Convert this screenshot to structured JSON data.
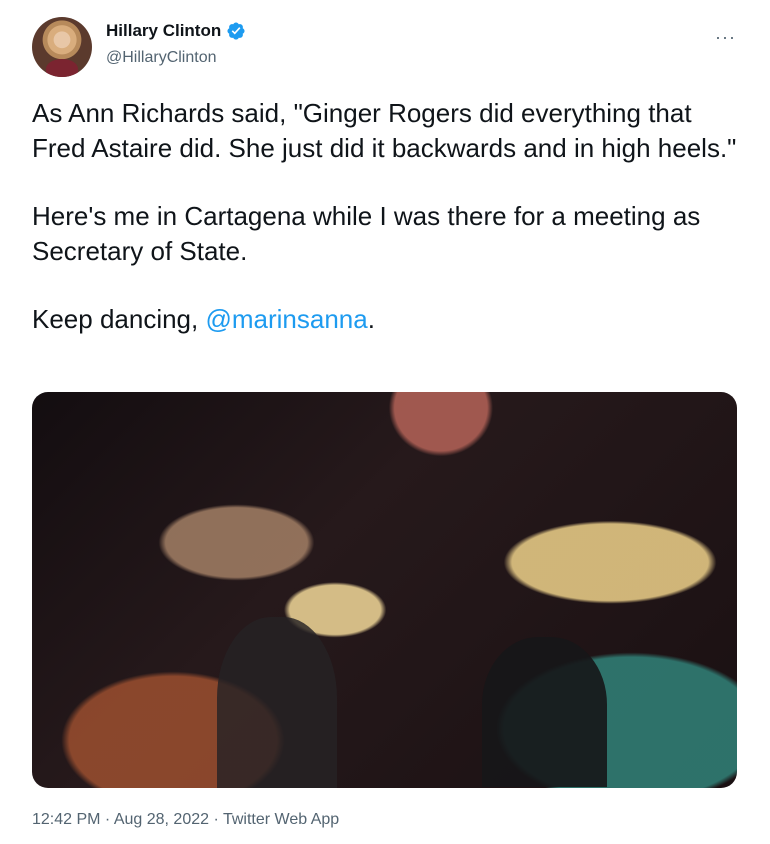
{
  "author": {
    "display_name": "Hillary Clinton",
    "handle": "@HillaryClinton",
    "verified_icon": "verified-badge-icon",
    "verified_color": "#1d9bf0"
  },
  "menu": {
    "more_label": "···"
  },
  "tweet": {
    "paragraph_1": "As Ann Richards said, \"Ginger Rogers did everything that Fred Astaire did. She just did it backwards and in high heels.\"",
    "paragraph_2": "Here's me in Cartagena while I was there for a meeting as Secretary of State.",
    "paragraph_3_prefix": "Keep dancing, ",
    "mention": "@marinsanna",
    "paragraph_3_suffix": "."
  },
  "meta": {
    "time": "12:42 PM",
    "separator": " · ",
    "date": "Aug 28, 2022",
    "source": "Twitter Web App"
  },
  "colors": {
    "text": "#0f1419",
    "secondary_text": "#536471",
    "link": "#1d9bf0",
    "background": "#ffffff"
  }
}
